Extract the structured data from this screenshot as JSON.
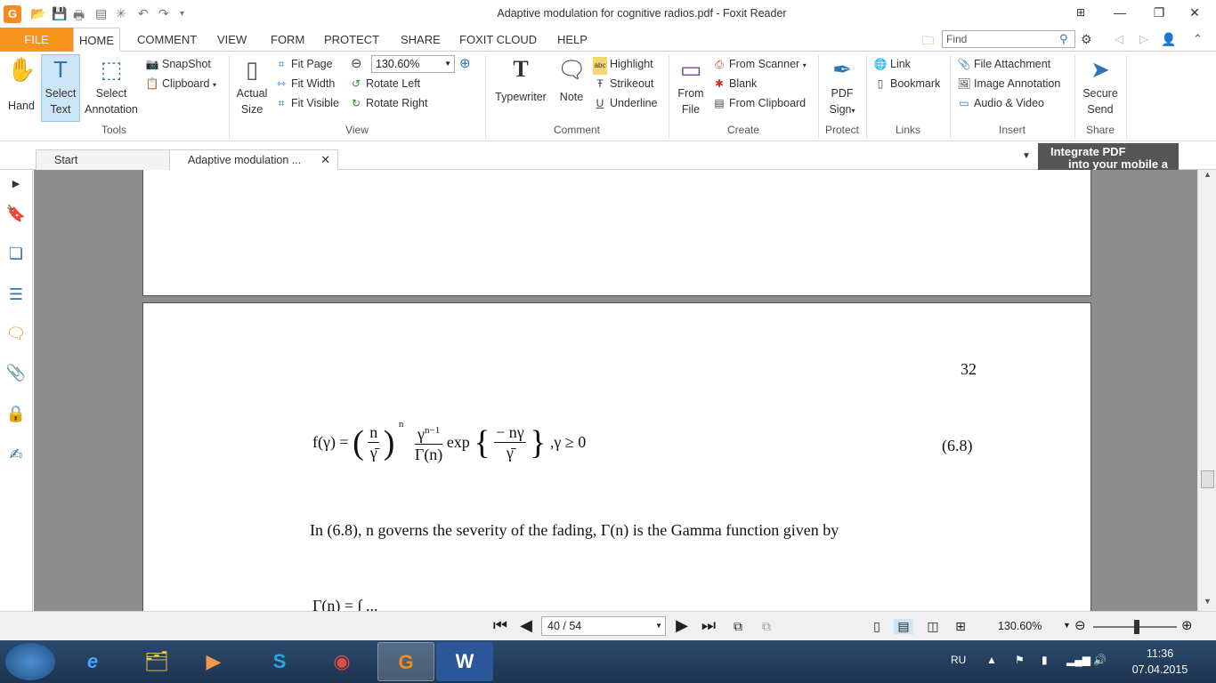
{
  "window": {
    "title": "Adaptive modulation for cognitive radios.pdf - Foxit Reader",
    "app_icon": "foxit-logo",
    "qa_icons": [
      "folder-open-icon",
      "save-icon",
      "print-icon",
      "properties-icon",
      "snapshot-icon",
      "undo-icon",
      "redo-icon",
      "customize-icon"
    ]
  },
  "menu": {
    "file": "FILE",
    "tabs": [
      "HOME",
      "COMMENT",
      "VIEW",
      "FORM",
      "PROTECT",
      "SHARE",
      "FOXIT CLOUD",
      "HELP"
    ],
    "active": "HOME",
    "search_placeholder": "Find"
  },
  "ribbon": {
    "tools": {
      "label": "Tools",
      "hand": "Hand",
      "select_text_1": "Select",
      "select_text_2": "Text",
      "select_annotation_1": "Select",
      "select_annotation_2": "Annotation",
      "snapshot": "SnapShot",
      "clipboard": "Clipboard"
    },
    "view": {
      "label": "View",
      "actual_size_1": "Actual",
      "actual_size_2": "Size",
      "fit_page": "Fit Page",
      "fit_width": "Fit Width",
      "fit_visible": "Fit Visible",
      "zoom": "130.60%",
      "rotate_left": "Rotate Left",
      "rotate_right": "Rotate Right"
    },
    "comment": {
      "label": "Comment",
      "typewriter": "Typewriter",
      "note": "Note",
      "highlight": "Highlight",
      "strikeout": "Strikeout",
      "underline": "Underline"
    },
    "create": {
      "label": "Create",
      "from_file_1": "From",
      "from_file_2": "File",
      "from_scanner": "From Scanner",
      "blank": "Blank",
      "from_clipboard": "From Clipboard"
    },
    "protect": {
      "label": "Protect",
      "pdf_sign_1": "PDF",
      "pdf_sign_2": "Sign"
    },
    "links": {
      "label": "Links",
      "link": "Link",
      "bookmark": "Bookmark"
    },
    "insert": {
      "label": "Insert",
      "file_attachment": "File Attachment",
      "image_annotation": "Image Annotation",
      "audio_video": "Audio & Video"
    },
    "share": {
      "label": "Share",
      "secure_send_1": "Secure",
      "secure_send_2": "Send"
    }
  },
  "doctabs": {
    "start": "Start",
    "active": "Adaptive modulation ...",
    "banner_1": "Integrate PDF",
    "banner_2": "into your mobile a"
  },
  "document": {
    "page_number": "32",
    "formula_lhs": "f(γ) = ",
    "formula_frac_n": "n",
    "formula_frac_gbar": "γ̄",
    "formula_exp_n": "n",
    "formula_gamma_pow": "γ",
    "formula_gamma_exp": "n−1",
    "formula_Gamma_n": "Γ(n)",
    "formula_exp": "exp",
    "formula_inner_num": "− nγ",
    "formula_inner_den": "γ̄",
    "formula_tail": ",γ ≥ 0",
    "eq_number": "(6.8)",
    "paragraph": "In (6.8), n governs the severity of the fading,  Γ(n)  is the Gamma function given by",
    "next_formula": "Γ(n) = ∫ ..."
  },
  "status": {
    "page": "40 / 54",
    "zoom": "130.60%"
  },
  "taskbar": {
    "apps": [
      "windows-explorer-icon",
      "internet-explorer-icon",
      "file-explorer-icon",
      "media-player-icon",
      "skype-icon",
      "chrome-icon",
      "foxit-pdf-icon",
      "word-icon"
    ],
    "language": "RU",
    "time": "11:36",
    "date": "07.04.2015"
  }
}
